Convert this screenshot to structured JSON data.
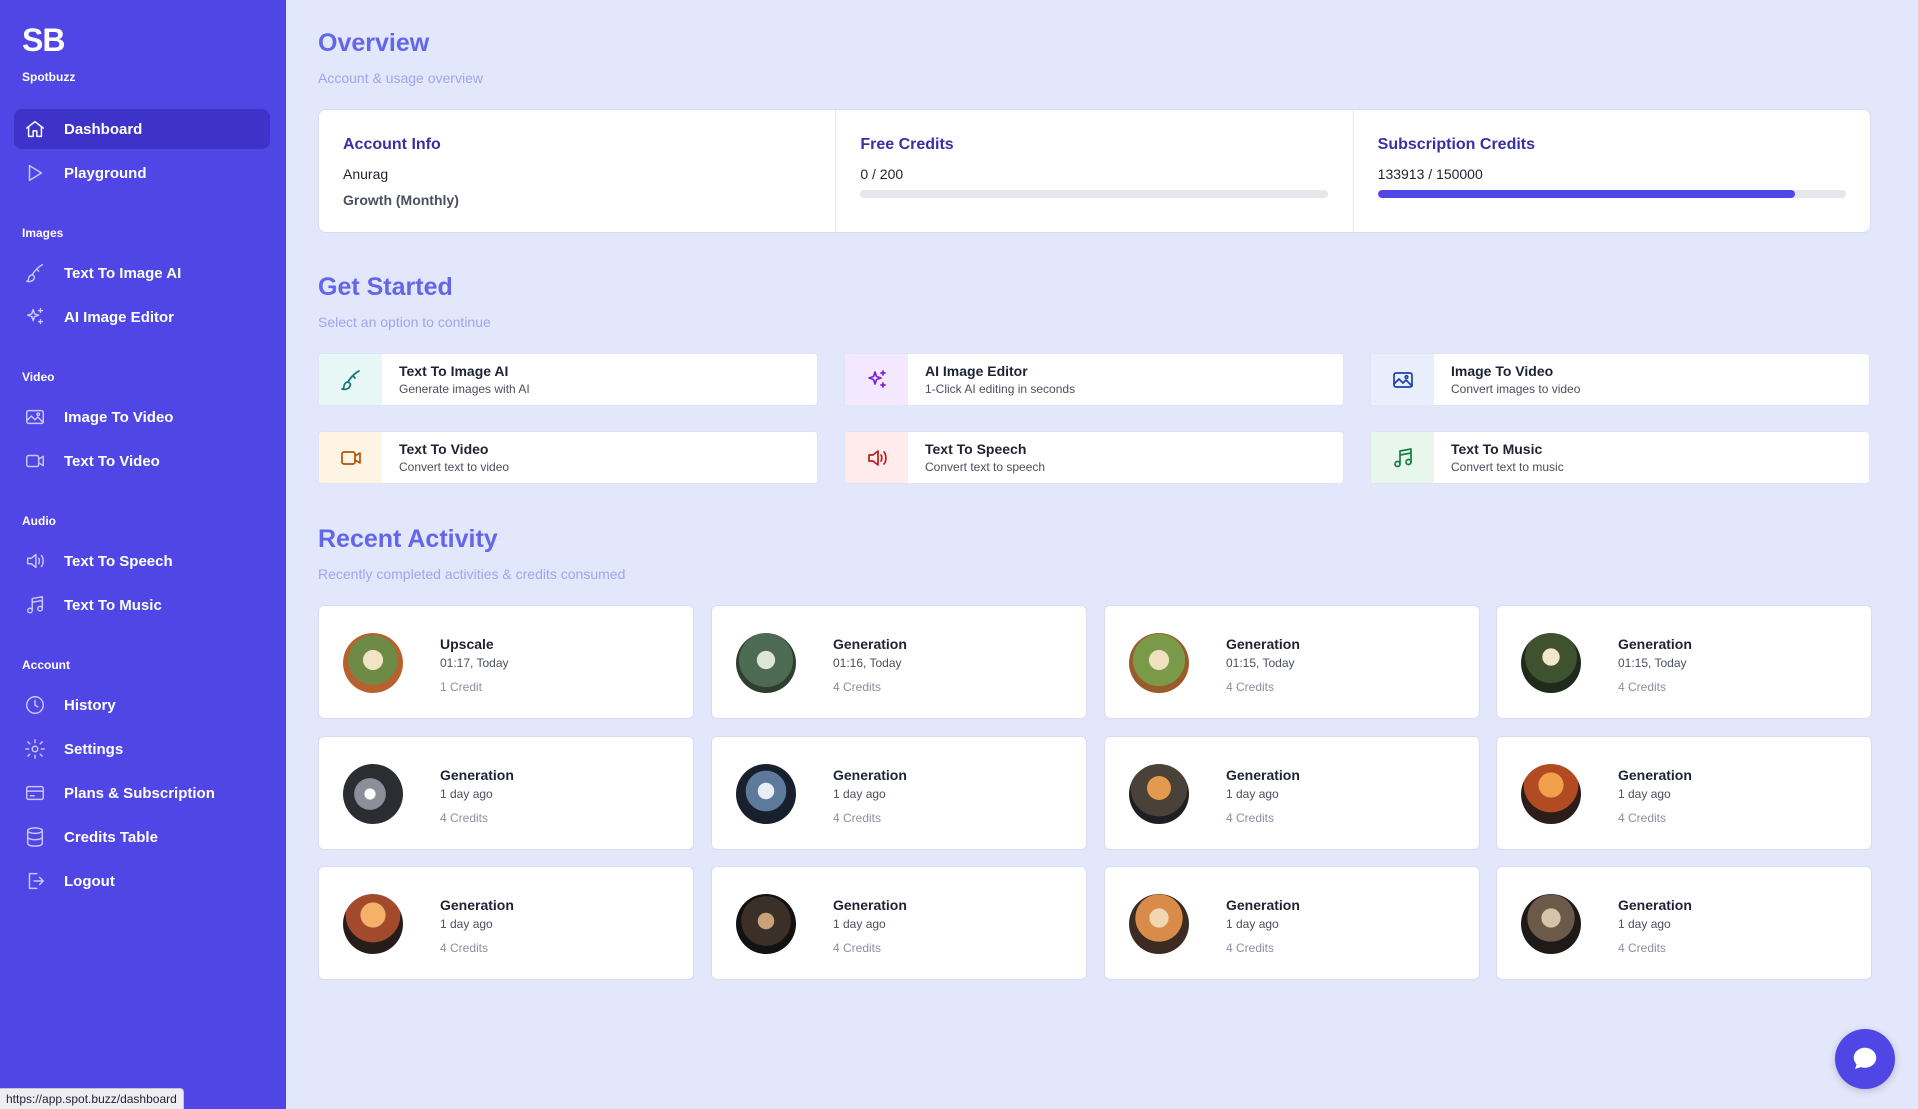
{
  "brand": {
    "logo": "SB",
    "name": "Spotbuzz"
  },
  "sidebar": {
    "items": [
      {
        "label": "Dashboard",
        "icon": "home-icon",
        "active": true
      },
      {
        "label": "Playground",
        "icon": "play-icon"
      },
      {
        "label": "Text To Image AI",
        "icon": "brush-icon"
      },
      {
        "label": "AI Image Editor",
        "icon": "sparkles-icon"
      },
      {
        "label": "Image To Video",
        "icon": "image-icon"
      },
      {
        "label": "Text To Video",
        "icon": "video-icon"
      },
      {
        "label": "Text To Speech",
        "icon": "speaker-icon"
      },
      {
        "label": "Text To Music",
        "icon": "music-icon"
      },
      {
        "label": "History",
        "icon": "clock-icon"
      },
      {
        "label": "Settings",
        "icon": "gear-icon"
      },
      {
        "label": "Plans & Subscription",
        "icon": "card-icon"
      },
      {
        "label": "Credits Table",
        "icon": "database-icon"
      },
      {
        "label": "Logout",
        "icon": "logout-icon"
      }
    ],
    "sections": [
      "Images",
      "Video",
      "Audio",
      "Account"
    ]
  },
  "overview": {
    "title": "Overview",
    "subtitle": "Account & usage overview"
  },
  "account": {
    "title": "Account Info",
    "name": "Anurag",
    "plan": "Growth (Monthly)",
    "free_title": "Free Credits",
    "free_value": "0 / 200",
    "free_fraction": 0.0,
    "sub_title": "Subscription Credits",
    "sub_value": "133913 / 150000",
    "sub_fraction": 0.8928
  },
  "get_started": {
    "title": "Get Started",
    "subtitle": "Select an option to continue",
    "cards": [
      {
        "title": "Text To Image AI",
        "desc": "Generate images with AI",
        "icon": "brush-icon",
        "color": "#0f766e",
        "bg": "#e6f7f5"
      },
      {
        "title": "AI Image Editor",
        "desc": "1-Click AI editing in seconds",
        "icon": "sparkles-icon",
        "color": "#7e22ce",
        "bg": "#f3e8fd"
      },
      {
        "title": "Image To Video",
        "desc": "Convert images to video",
        "icon": "image-icon",
        "color": "#1e40af",
        "bg": "#e8eefc"
      },
      {
        "title": "Text To Video",
        "desc": "Convert text to video",
        "icon": "video-icon",
        "color": "#b45309",
        "bg": "#fdf4e3"
      },
      {
        "title": "Text To Speech",
        "desc": "Convert text to speech",
        "icon": "speaker-icon",
        "color": "#b91c1c",
        "bg": "#fdeceb"
      },
      {
        "title": "Text To Music",
        "desc": "Convert text to music",
        "icon": "music-icon",
        "color": "#15803d",
        "bg": "#e7f7ec"
      }
    ]
  },
  "recent": {
    "title": "Recent Activity",
    "subtitle": "Recently completed activities & credits consumed",
    "items": [
      {
        "title": "Upscale",
        "time": "01:17, Today",
        "credits": "1 Credit"
      },
      {
        "title": "Generation",
        "time": "01:16, Today",
        "credits": "4 Credits"
      },
      {
        "title": "Generation",
        "time": "01:15, Today",
        "credits": "4 Credits"
      },
      {
        "title": "Generation",
        "time": "01:15, Today",
        "credits": "4 Credits"
      },
      {
        "title": "Generation",
        "time": "1 day ago",
        "credits": "4 Credits"
      },
      {
        "title": "Generation",
        "time": "1 day ago",
        "credits": "4 Credits"
      },
      {
        "title": "Generation",
        "time": "1 day ago",
        "credits": "4 Credits"
      },
      {
        "title": "Generation",
        "time": "1 day ago",
        "credits": "4 Credits"
      },
      {
        "title": "Generation",
        "time": "1 day ago",
        "credits": "4 Credits"
      },
      {
        "title": "Generation",
        "time": "1 day ago",
        "credits": "4 Credits"
      },
      {
        "title": "Generation",
        "time": "1 day ago",
        "credits": "4 Credits"
      },
      {
        "title": "Generation",
        "time": "1 day ago",
        "credits": "4 Credits"
      }
    ]
  },
  "status_url": "https://app.spot.buzz/dashboard"
}
